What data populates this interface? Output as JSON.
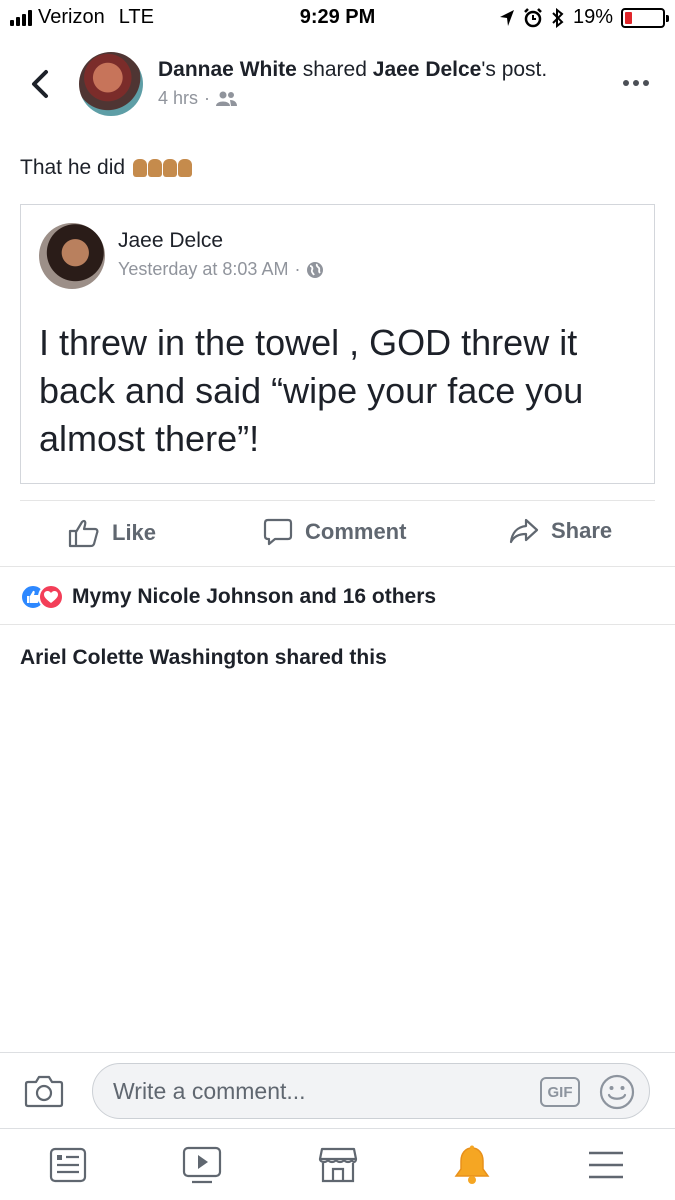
{
  "status_bar": {
    "carrier": "Verizon",
    "network": "LTE",
    "time": "9:29 PM",
    "battery": "19%",
    "battery_level": 0.19,
    "battery_color": "#e0262b"
  },
  "header": {
    "author": "Dannae White",
    "action": "shared",
    "shared_from": "Jaee Delce",
    "suffix": "'s post.",
    "time": "4 hrs",
    "separator": "·",
    "audience_icon": "friends-icon"
  },
  "post": {
    "text": "That he did",
    "emoji_icon": "raising-hands-emoji"
  },
  "shared_post": {
    "author": "Jaee Delce",
    "time": "Yesterday at 8:03 AM",
    "separator": "·",
    "audience_icon": "globe-icon",
    "body": "I threw in the towel , GOD threw it back and said “wipe your face you almost there”!"
  },
  "actions": {
    "like": "Like",
    "comment": "Comment",
    "share": "Share"
  },
  "reactions": {
    "text": "Mymy Nicole Johnson and 16 others",
    "like_color": "#2d88ff",
    "love_color": "#f33e58"
  },
  "shared_by": "Ariel Colette Washington shared this",
  "comment_bar": {
    "placeholder": "Write a comment...",
    "gif": "GIF"
  },
  "bottom_nav": [
    "news-feed-icon",
    "watch-icon",
    "marketplace-icon",
    "notifications-icon",
    "menu-icon"
  ],
  "accent_color": "#f5a623"
}
